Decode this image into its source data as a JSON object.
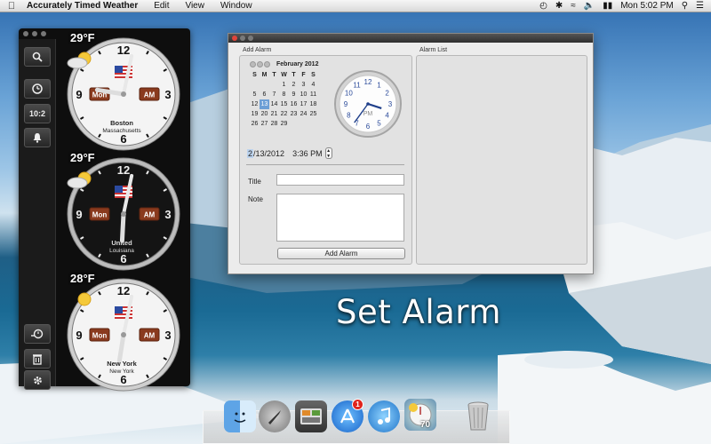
{
  "menubar": {
    "app_name": "Accurately Timed Weather",
    "menus": [
      "Edit",
      "View",
      "Window"
    ],
    "clock": "Mon 5:02 PM"
  },
  "clock_panel": {
    "sidebar_buttons": [
      "search-icon",
      "clock-icon",
      "10:2",
      "bell-icon",
      "add-clock-icon",
      "trash-icon",
      "gear-icon"
    ],
    "clocks": [
      {
        "temp": "29°F",
        "weather": "partly-cloudy",
        "day": "Mon",
        "ampm": "AM",
        "city": "Boston",
        "region": "Massachusetts",
        "face": "light",
        "hour": 9.3,
        "minute": 2
      },
      {
        "temp": "29°F",
        "weather": "cloudy",
        "day": "Mon",
        "ampm": "AM",
        "city": "United",
        "region": "Louisiana",
        "face": "dark",
        "hour": 6.1,
        "minute": 2
      },
      {
        "temp": "28°F",
        "weather": "sunny",
        "day": "Mon",
        "ampm": "AM",
        "city": "New York",
        "region": "New York",
        "face": "light",
        "hour": 6.3,
        "minute": 2
      }
    ]
  },
  "alarm_window": {
    "add_alarm_label": "Add Alarm",
    "alarm_list_label": "Alarm List",
    "calendar": {
      "month": "February 2012",
      "weekdays": [
        "S",
        "M",
        "T",
        "W",
        "T",
        "F",
        "S"
      ],
      "weeks": [
        [
          "",
          "",
          "",
          "1",
          "2",
          "3",
          "4"
        ],
        [
          "5",
          "6",
          "7",
          "8",
          "9",
          "10",
          "11"
        ],
        [
          "12",
          "13",
          "14",
          "15",
          "16",
          "17",
          "18"
        ],
        [
          "19",
          "20",
          "21",
          "22",
          "23",
          "24",
          "25"
        ],
        [
          "26",
          "27",
          "28",
          "29",
          "",
          "",
          ""
        ]
      ],
      "selected_day": "13"
    },
    "analog_clock": {
      "pm_label": "PM",
      "hour": 3.6,
      "minute": 36
    },
    "date_field": {
      "month_part": "2",
      "rest": "/13/2012",
      "time": "3:36 PM"
    },
    "title_label": "Title",
    "note_label": "Note",
    "title_value": "",
    "note_value": "",
    "add_button": "Add Alarm"
  },
  "caption": "Set Alarm",
  "dock": {
    "apps": [
      "finder-icon",
      "launchpad-icon",
      "system-preferences-icon",
      "app-store-icon",
      "itunes-icon",
      "weather-app-icon",
      "trash-icon"
    ],
    "app_store_badge": "1",
    "weather_temp": "70"
  }
}
